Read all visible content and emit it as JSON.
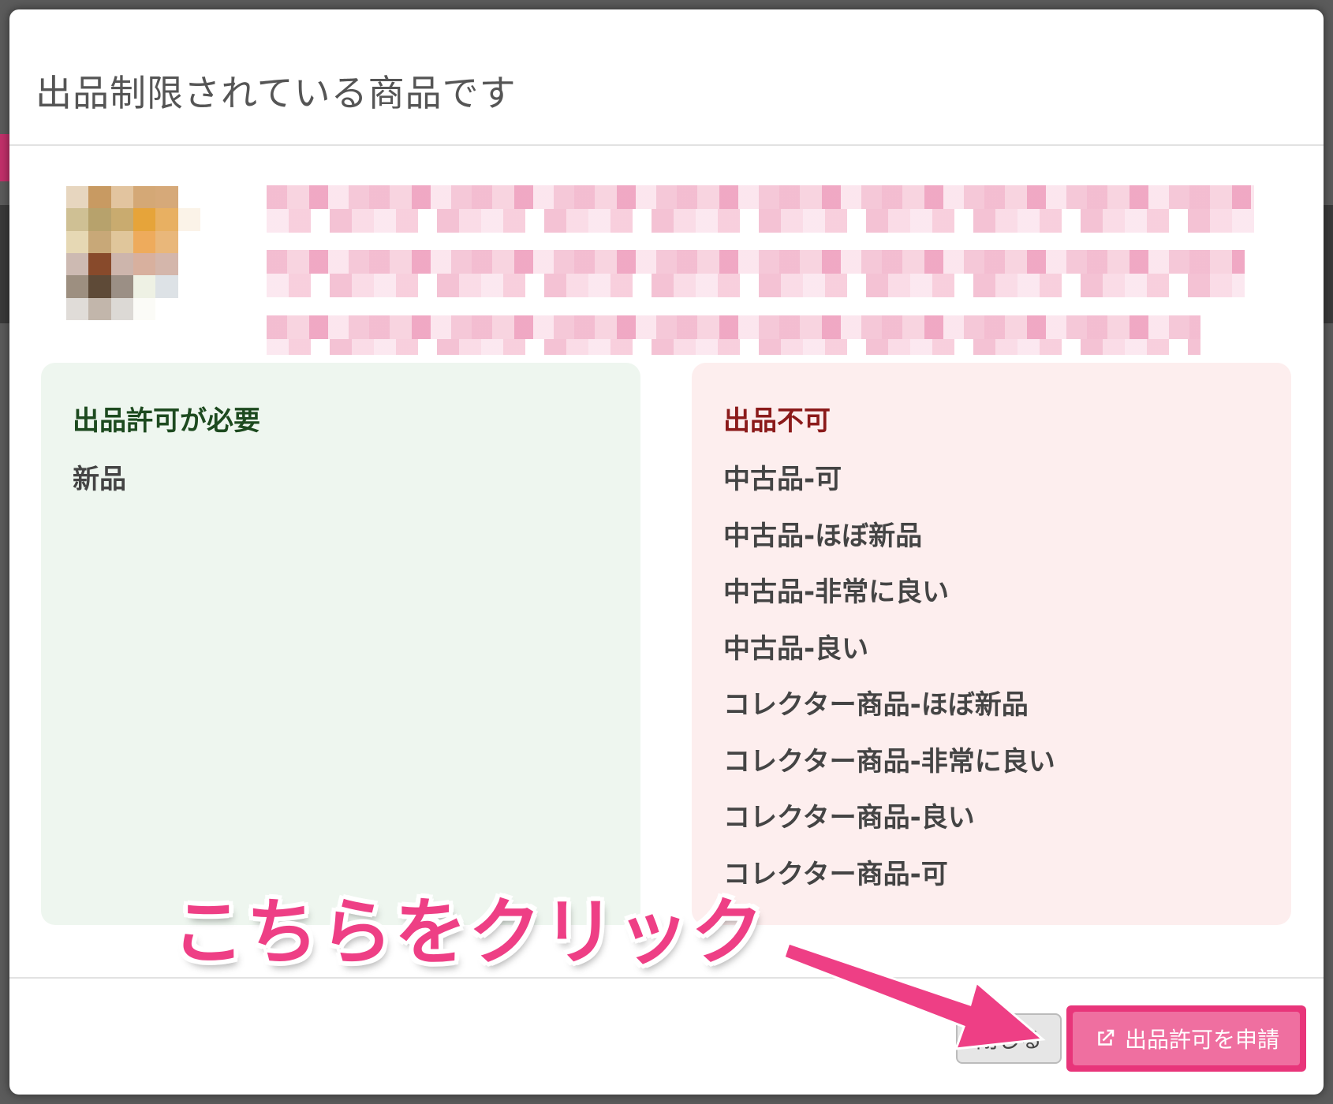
{
  "modal": {
    "title": "出品制限されている商品です"
  },
  "panels": {
    "requires_permission": {
      "heading": "出品許可が必要",
      "items": [
        "新品"
      ]
    },
    "not_allowed": {
      "heading": "出品不可",
      "items": [
        "中古品-可",
        "中古品-ほぼ新品",
        "中古品-非常に良い",
        "中古品-良い",
        "コレクター商品-ほぼ新品",
        "コレクター商品-非常に良い",
        "コレクター商品-良い",
        "コレクター商品-可"
      ]
    }
  },
  "footer": {
    "close_label": "閉じる",
    "apply_label": "出品許可を申請"
  },
  "annotation": {
    "text": "こちらをクリック"
  },
  "colors": {
    "accent_pink": "#e8357a",
    "green_panel": "#eef6ef",
    "red_panel": "#fdeeee"
  },
  "icons": [
    "external-link-icon",
    "arrow-annotation"
  ]
}
